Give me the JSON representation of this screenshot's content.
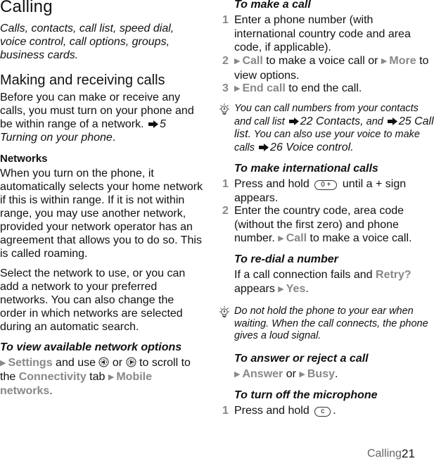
{
  "page": {
    "title": "Calling",
    "intro": "Calls, contacts, call list, speed dial, voice control, call options, groups, business cards.",
    "section_heading": "Making and receiving calls",
    "section_para_before": "Before you can make or receive any calls, you must turn on your phone and be within range of a network.",
    "section_ref": "5 Turning on your phone",
    "networks": {
      "heading": "Networks",
      "para1": "When you turn on the phone, it automatically selects your home network if this is within range. If it is not within range, you may use another network, provided your network operator has an agreement that allows you to do so. This is called roaming.",
      "para2": "Select the network to use, or you can add a network to your preferred networks. You can also change the order in which networks are selected during an automatic search."
    },
    "view_options": {
      "heading": "To view available network options",
      "menu_settings": "Settings",
      "t1": "and use",
      "t2": "or",
      "t3": "to scroll to the",
      "menu_connectivity": "Connectivity",
      "t4": "tab",
      "menu_mobile_networks": "Mobile networks",
      "nav_left_icon": "navigation-left-key",
      "nav_right_icon": "navigation-right-key"
    },
    "make_call": {
      "heading": "To make a call",
      "steps": [
        {
          "num": "1",
          "text": "Enter a phone number (with international country code and area code, if applicable)."
        },
        {
          "num": "2",
          "menu1": "Call",
          "t1": "to make a voice call or",
          "menu2": "More",
          "t2": "to view options."
        },
        {
          "num": "3",
          "menu1": "End call",
          "t1": "to end the call."
        }
      ]
    },
    "tip1": {
      "icon": "lightbulb-tip",
      "t1": "You can call numbers from your contacts and call list",
      "ref1": "22 Contacts,",
      "t2": "and",
      "ref2": "25 Call list.",
      "t3": "You can also use your voice to make calls",
      "ref3": "26 Voice control."
    },
    "intl_call": {
      "heading": "To make international calls",
      "steps": [
        {
          "num": "1",
          "t1": "Press and hold",
          "key": "0 +",
          "t2": "until a + sign appears."
        },
        {
          "num": "2",
          "t1": "Enter the country code, area code (without the first zero) and phone number.",
          "menu1": "Call",
          "t2": "to make a voice call."
        }
      ]
    },
    "redial": {
      "heading": "To re-dial a number",
      "t1": "If a call connection fails and",
      "menu1": "Retry?",
      "t2": "appears",
      "menu2": "Yes",
      "t3": "."
    },
    "tip2": {
      "icon": "lightbulb-tip",
      "text": "Do not hold the phone to your ear when waiting. When the call connects, the phone gives a loud signal."
    },
    "answer": {
      "heading": "To answer or reject a call",
      "menu1": "Answer",
      "t1": "or",
      "menu2": "Busy",
      "t2": "."
    },
    "mic": {
      "heading": "To turn off the microphone",
      "steps": [
        {
          "num": "1",
          "t1": "Press and hold",
          "key": "c",
          "t2": "."
        }
      ]
    },
    "footer": {
      "section": "Calling",
      "page_number": "21"
    },
    "colors": {
      "menu_gray": "#888888",
      "text": "#111111"
    }
  }
}
